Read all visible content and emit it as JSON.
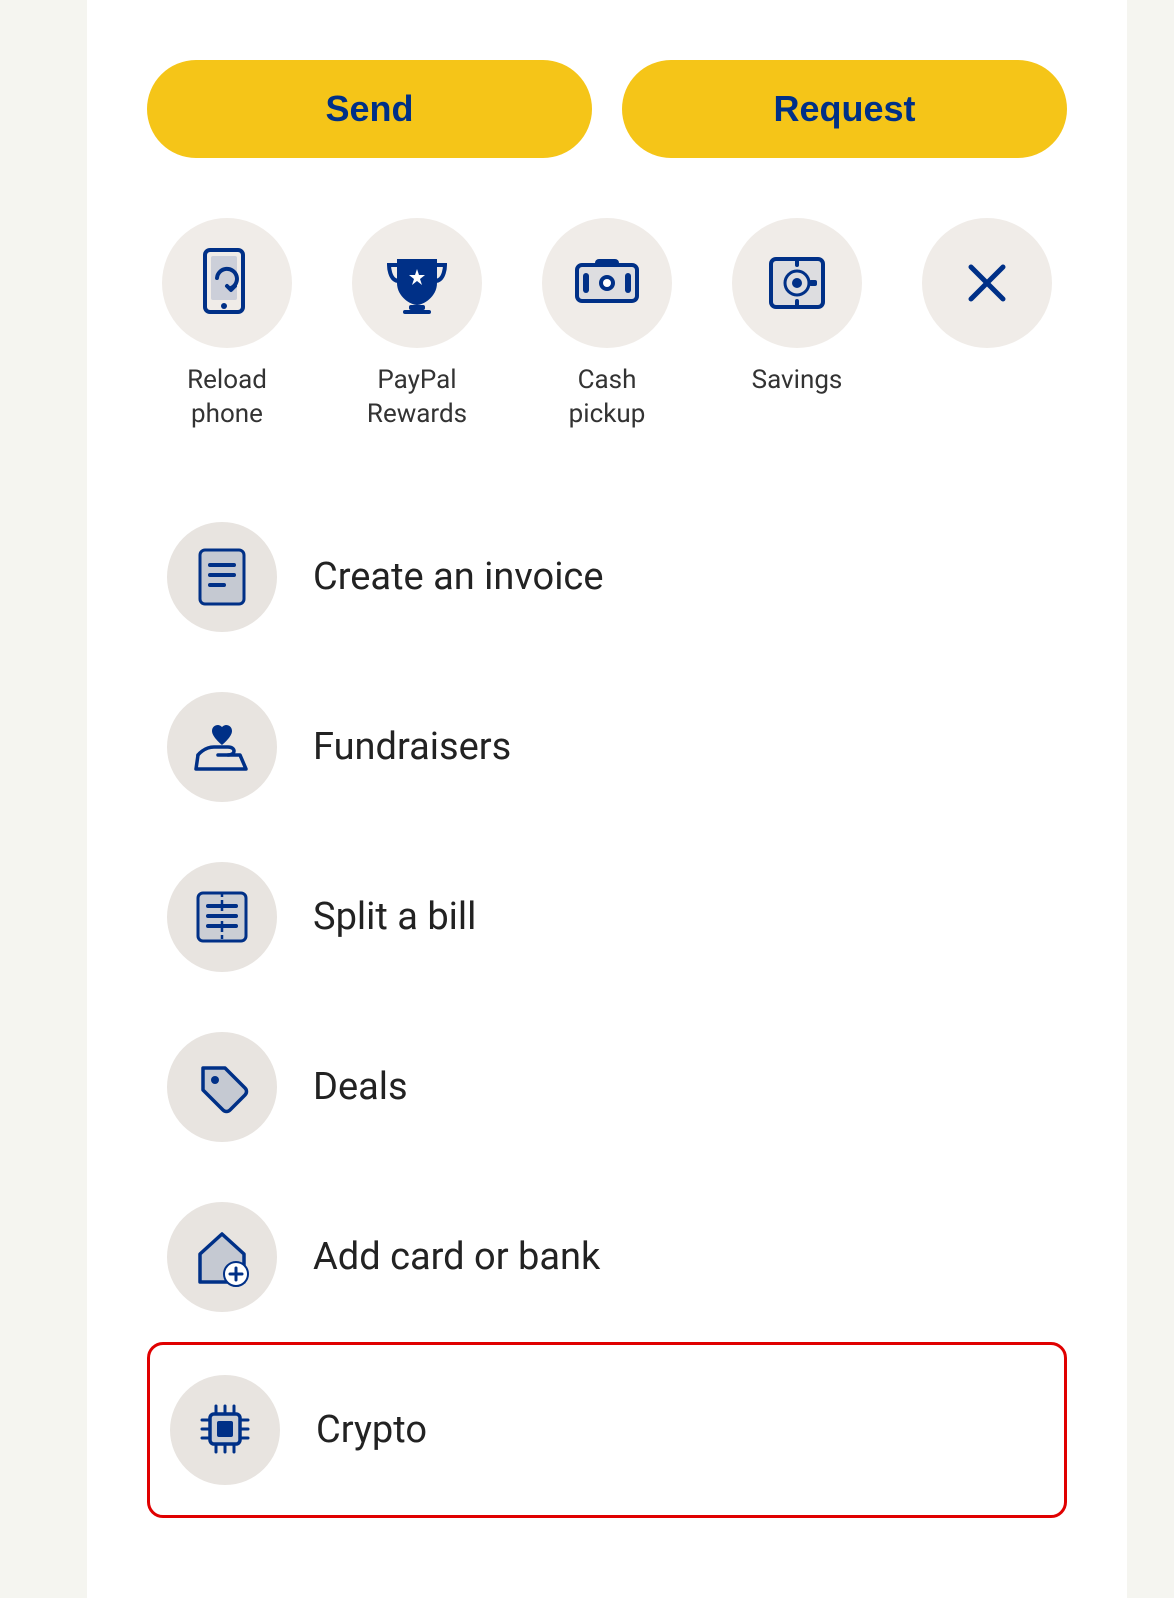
{
  "buttons": {
    "send_label": "Send",
    "request_label": "Request"
  },
  "quick_actions": [
    {
      "id": "reload-phone",
      "label": "Reload\nphone",
      "icon": "phone-reload-icon"
    },
    {
      "id": "paypal-rewards",
      "label": "PayPal\nRewards",
      "icon": "trophy-icon"
    },
    {
      "id": "cash-pickup",
      "label": "Cash\npickup",
      "icon": "cash-pickup-icon"
    },
    {
      "id": "savings",
      "label": "Savings",
      "icon": "savings-icon"
    },
    {
      "id": "close",
      "label": "",
      "icon": "close-icon"
    }
  ],
  "list_items": [
    {
      "id": "create-invoice",
      "label": "Create an invoice",
      "icon": "invoice-icon",
      "highlighted": false
    },
    {
      "id": "fundraisers",
      "label": "Fundraisers",
      "icon": "fundraisers-icon",
      "highlighted": false
    },
    {
      "id": "split-bill",
      "label": "Split a bill",
      "icon": "split-bill-icon",
      "highlighted": false
    },
    {
      "id": "deals",
      "label": "Deals",
      "icon": "deals-icon",
      "highlighted": false
    },
    {
      "id": "add-card-bank",
      "label": "Add card or bank",
      "icon": "add-card-icon",
      "highlighted": false
    },
    {
      "id": "crypto",
      "label": "Crypto",
      "icon": "crypto-icon",
      "highlighted": true
    }
  ],
  "colors": {
    "brand_blue": "#003087",
    "brand_yellow": "#F5C518",
    "icon_bg": "#e8e4e0",
    "highlight_border": "#e00000"
  }
}
